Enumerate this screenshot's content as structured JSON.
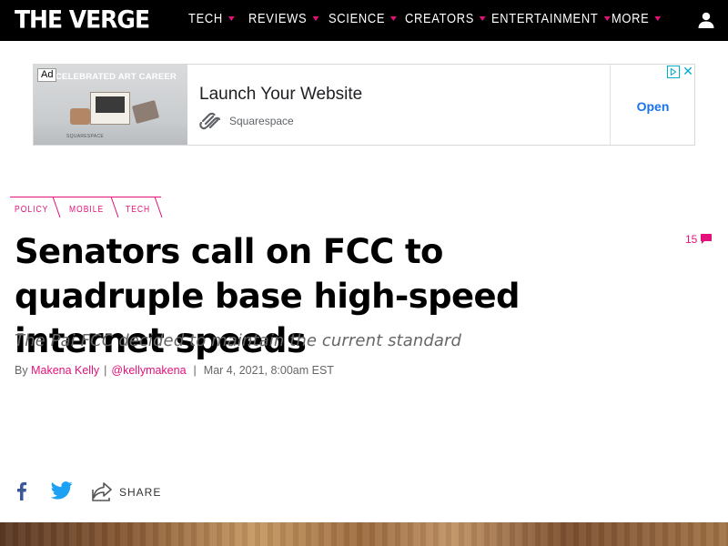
{
  "nav": {
    "logo": "THE VERGE",
    "items": [
      {
        "label": "TECH"
      },
      {
        "label": "REVIEWS"
      },
      {
        "label": "SCIENCE"
      },
      {
        "label": "CREATORS"
      },
      {
        "label": "ENTERTAINMENT"
      },
      {
        "label": "MORE"
      }
    ],
    "accent_color": "#e2127a"
  },
  "ad": {
    "badge": "Ad",
    "image_caption": "CELEBRATED ART CAREER",
    "image_sub": "SQUARESPACE",
    "title": "Launch Your Website",
    "brand": "Squarespace",
    "cta": "Open"
  },
  "article": {
    "tags": [
      "POLICY",
      "MOBILE",
      "TECH"
    ],
    "comments_count": "15",
    "headline": "Senators call on FCC to quadruple base high-speed internet speeds",
    "dek": "The Pai FCC decided to maintain the current standard",
    "byline": {
      "by": "By",
      "author": "Makena Kelly",
      "handle": "@kellymakena",
      "date": "Mar 4, 2021, 8:00am EST"
    }
  },
  "share": {
    "label": "SHARE",
    "icons": [
      "facebook-icon",
      "twitter-icon",
      "share-icon"
    ]
  }
}
